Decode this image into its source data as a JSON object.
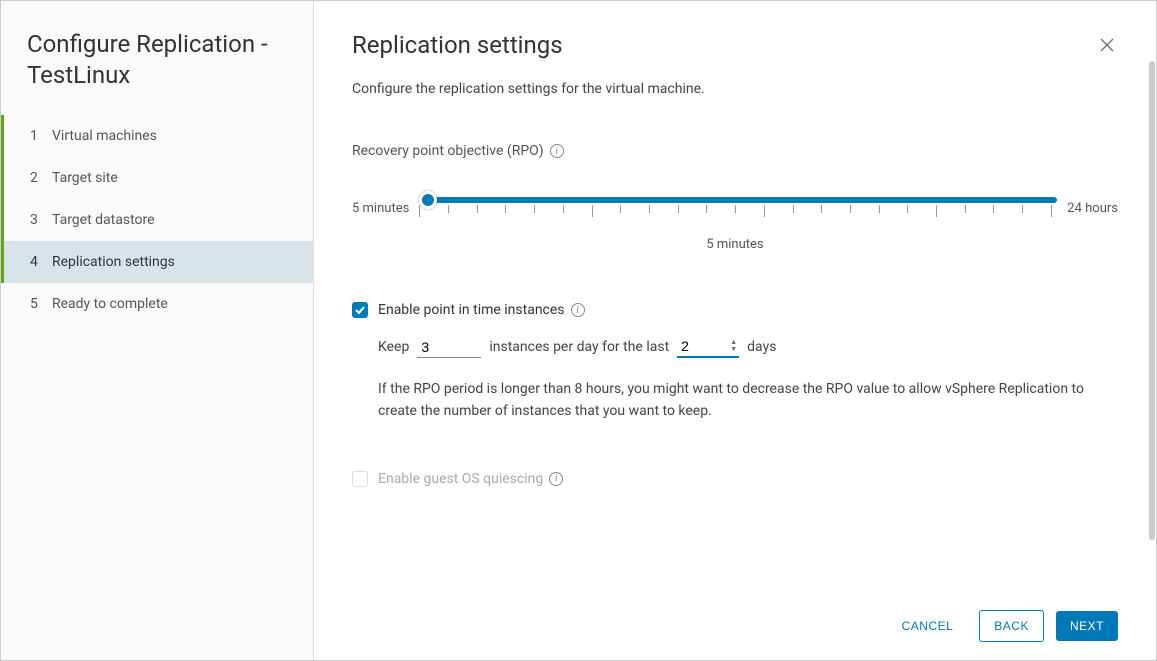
{
  "sidebar": {
    "title": "Configure Replication - TestLinux",
    "steps": [
      {
        "num": "1",
        "label": "Virtual machines",
        "state": "completed"
      },
      {
        "num": "2",
        "label": "Target site",
        "state": "completed"
      },
      {
        "num": "3",
        "label": "Target datastore",
        "state": "completed"
      },
      {
        "num": "4",
        "label": "Replication settings",
        "state": "active"
      },
      {
        "num": "5",
        "label": "Ready to complete",
        "state": "pending"
      }
    ]
  },
  "main": {
    "title": "Replication settings",
    "subtitle": "Configure the replication settings for the virtual machine.",
    "rpo": {
      "label": "Recovery point objective (RPO)",
      "min_label": "5 minutes",
      "max_label": "24 hours",
      "value_label": "5 minutes"
    },
    "pit": {
      "enabled": true,
      "label": "Enable point in time instances",
      "keep_label": "Keep",
      "instances_value": "3",
      "mid_label": "instances per day for the last",
      "days_value": "2",
      "days_label": "days",
      "hint": "If the RPO period is longer than 8 hours, you might want to decrease the RPO value to allow vSphere Replication to create the number of instances that you want to keep."
    },
    "quiescing": {
      "enabled": false,
      "label": "Enable guest OS quiescing"
    }
  },
  "footer": {
    "cancel": "CANCEL",
    "back": "BACK",
    "next": "NEXT"
  }
}
